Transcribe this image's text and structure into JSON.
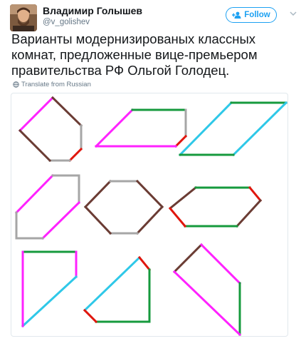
{
  "author": {
    "name": "Владимир Голышев",
    "handle": "@v_golishev"
  },
  "follow": {
    "label": "Follow"
  },
  "tweet": {
    "text": "Варианты модернизированых классных комнат, предложенные вице-премьером правительства РФ Ольгой Голодец."
  },
  "translate": {
    "label": "Translate from Russian"
  },
  "colors": {
    "magenta": "#ff22ff",
    "brown": "#6b3c34",
    "gray": "#a6a6a6",
    "red": "#e0160d",
    "green": "#169a3d",
    "cyan": "#2fc8e8",
    "link": "#1da1f2"
  },
  "icons": {
    "avatar": "user-photo",
    "follow": "add-user-icon",
    "caret": "chevron-down-icon",
    "translate": "globe-icon"
  }
}
